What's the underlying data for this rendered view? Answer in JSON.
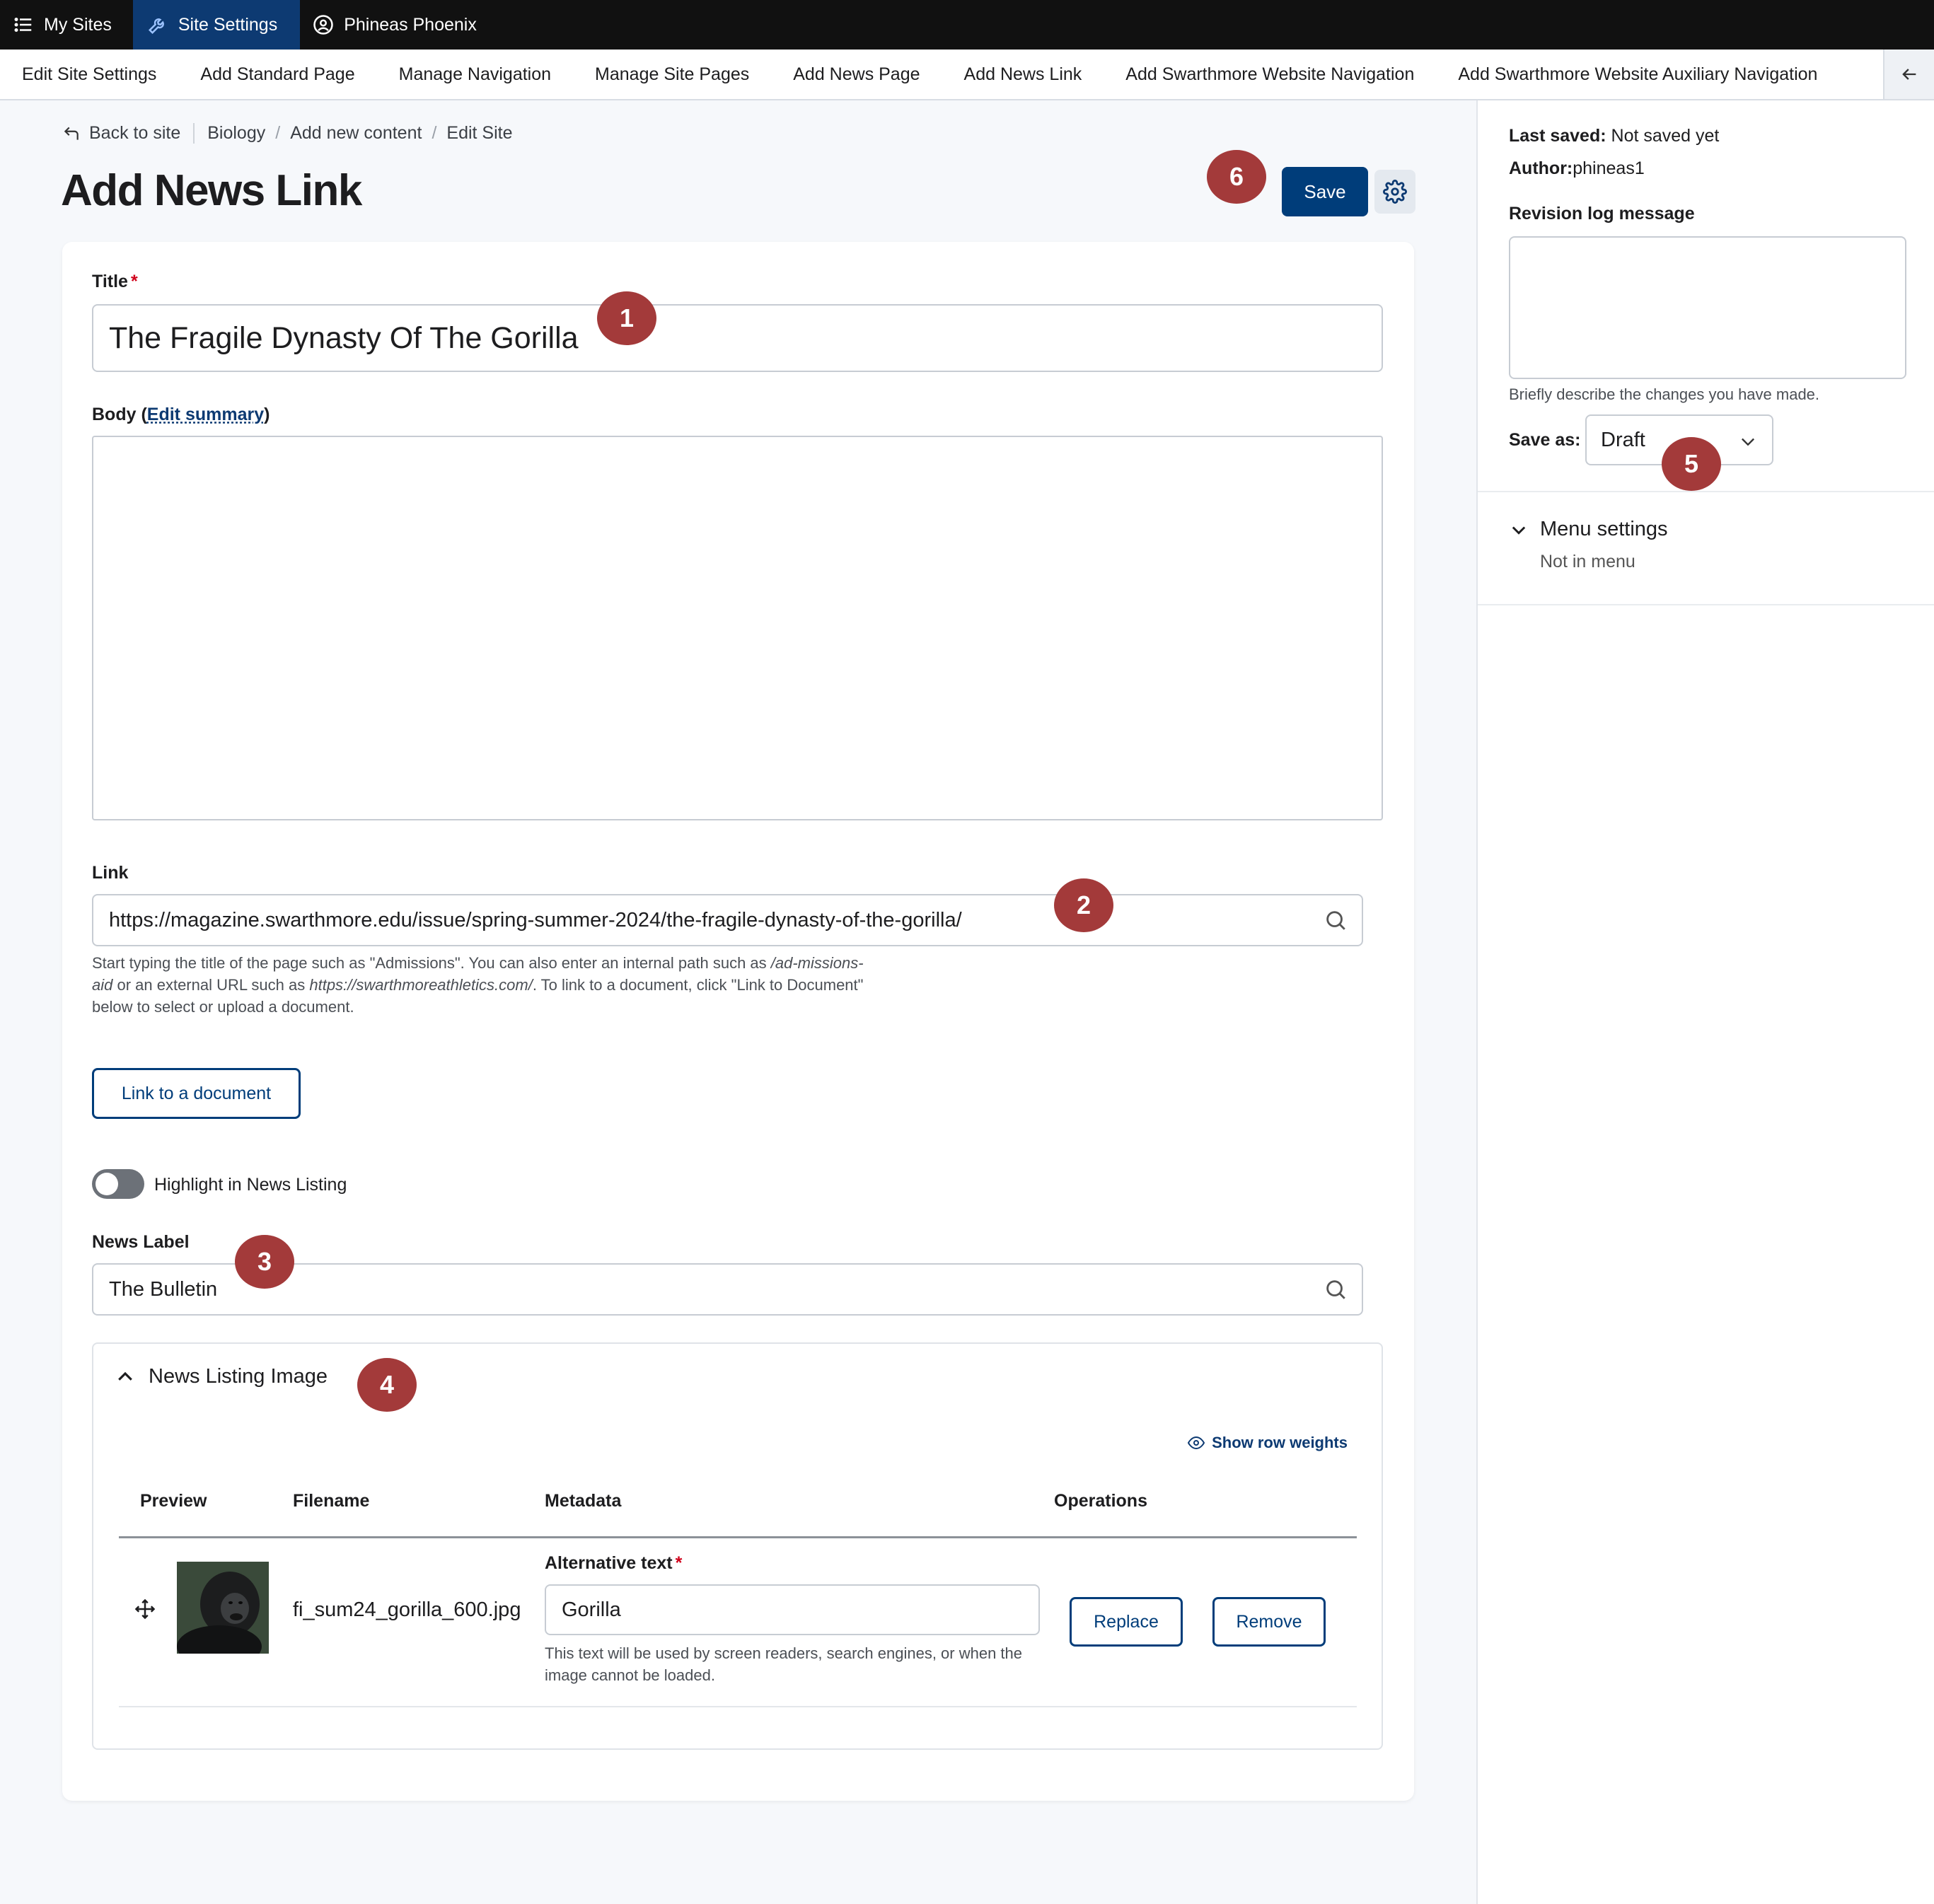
{
  "toolbar": {
    "my_sites": "My Sites",
    "site_settings": "Site Settings",
    "user": "Phineas Phoenix"
  },
  "tray": {
    "items": [
      "Edit Site Settings",
      "Add Standard Page",
      "Manage Navigation",
      "Manage Site Pages",
      "Add News Page",
      "Add News Link",
      "Add Swarthmore Website Navigation",
      "Add Swarthmore Website Auxiliary Navigation"
    ]
  },
  "breadcrumb": {
    "back": "Back to site",
    "items": [
      "Biology",
      "Add new content",
      "Edit Site"
    ]
  },
  "page": {
    "title": "Add News Link",
    "save_label": "Save"
  },
  "form": {
    "title_label": "Title",
    "title_value": "The Fragile Dynasty Of The Gorilla",
    "body_label": "Body (",
    "body_link": "Edit summary",
    "body_label_end": ")",
    "link_label": "Link",
    "link_value": "https://magazine.swarthmore.edu/issue/spring-summer-2024/the-fragile-dynasty-of-the-gorilla/",
    "link_help_1": "Start typing the title of the page such as \"Admissions\". You can also enter an internal path such as ",
    "link_help_path": "/ad-missions-aid",
    "link_help_2": " or an external URL such as ",
    "link_help_url": "https://swarthmoreathletics.com/",
    "link_help_3": ". To link to a document, click \"Link to Document\" below to select or upload a document.",
    "link_doc_button": "Link to a document",
    "highlight_label": "Highlight in News Listing",
    "news_label_label": "News Label",
    "news_label_value": "The Bulletin"
  },
  "image_section": {
    "title": "News Listing Image",
    "row_weights": "Show row weights",
    "columns": [
      "Preview",
      "Filename",
      "Metadata",
      "Operations"
    ],
    "row": {
      "filename": "fi_sum24_gorilla_600.jpg",
      "alt_label": "Alternative text",
      "alt_value": "Gorilla",
      "alt_help": "This text will be used by screen readers, search engines, or when the image cannot be loaded.",
      "replace": "Replace",
      "remove": "Remove"
    }
  },
  "sidebar": {
    "last_saved_label": "Last saved:",
    "last_saved_value": "Not saved yet",
    "author_label": "Author:",
    "author_value": "phineas1",
    "revision_label": "Revision log message",
    "revision_help": "Briefly describe the changes you have made.",
    "save_as_label": "Save as:",
    "save_as_value": "Draft",
    "menu_settings": "Menu settings",
    "menu_status": "Not in menu"
  },
  "badges": [
    "1",
    "2",
    "3",
    "4",
    "5",
    "6"
  ],
  "colors": {
    "primary": "#003d7a",
    "toolbar_bg": "#111111",
    "toolbar_active": "#0d3a72",
    "badge": "#a33a3a",
    "required": "#d0021b"
  }
}
